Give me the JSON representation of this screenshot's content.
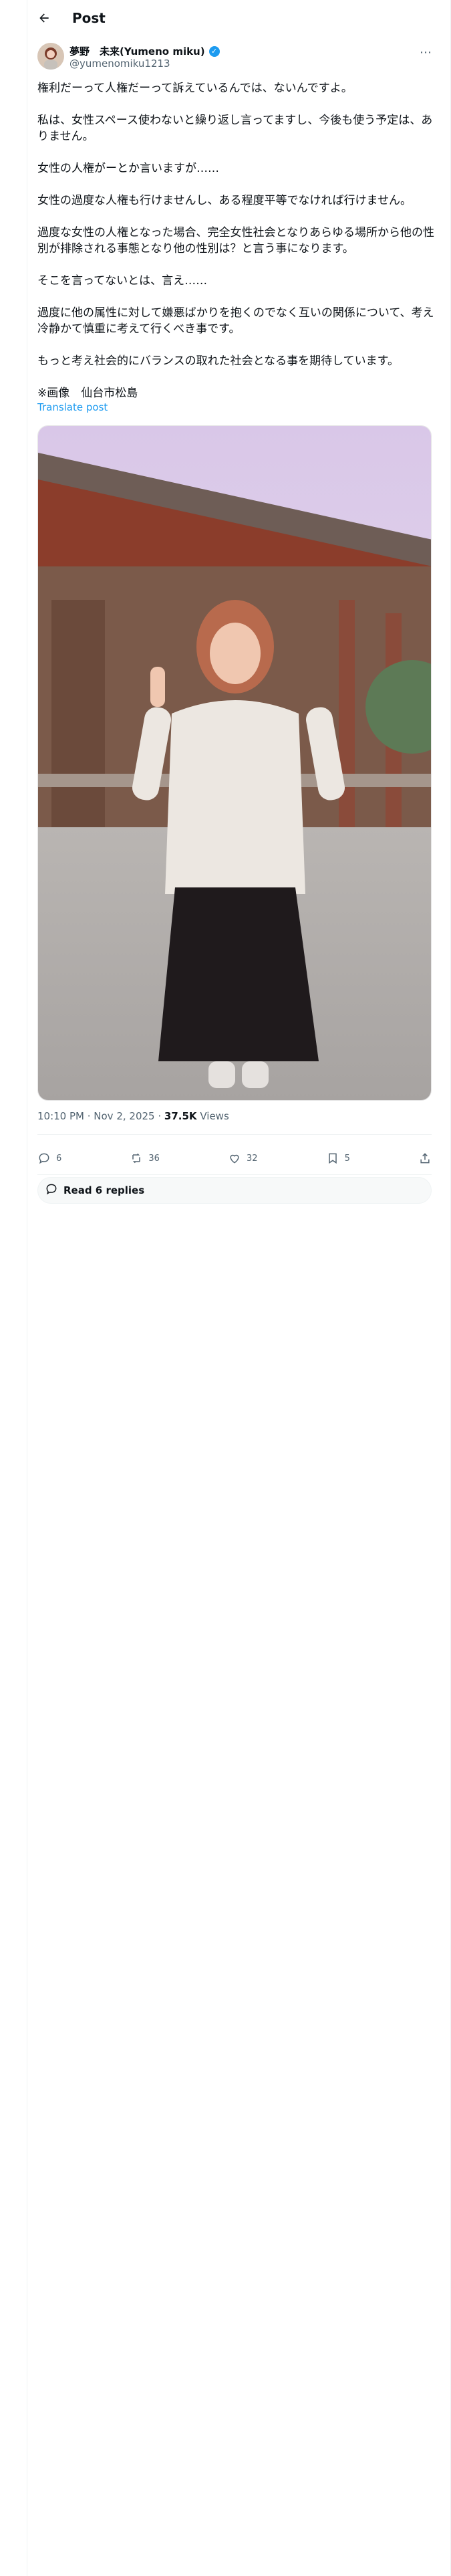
{
  "header": {
    "title": "Post"
  },
  "author": {
    "name": "夢野　未来(Yumeno miku)",
    "handle": "@yumenomiku1213"
  },
  "post": {
    "paragraphs": [
      "権利だーって人権だーって訴えているんでは、ないんですよ。",
      "私は、女性スペース使わないと繰り返し言ってますし、今後も使う予定は、ありません。",
      "女性の人権がーとか言いますが……",
      "女性の過度な人権も行けませんし、ある程度平等でなければ行けません。",
      "過度な女性の人権となった場合、完全女性社会となりあらゆる場所から他の性別が排除される事態となり他の性別は？と言う事になります。",
      "そこを言ってないとは、言え……",
      "過度に他の属性に対して嫌悪ばかりを抱くのでなく互いの関係について、考え冷静かて慎重に考えて行くべき事です。",
      "もっと考え社会的にバランスの取れた社会となる事を期待しています。",
      "※画像　仙台市松島"
    ],
    "translate": "Translate post",
    "time": "10:10 PM · Nov 2, 2025",
    "views_count": "37.5K",
    "views_label": "Views"
  },
  "actions": {
    "replies": "6",
    "reposts": "36",
    "likes": "32",
    "bookmarks": "5"
  },
  "read_replies": "Read 6 replies",
  "icons": [
    "back-arrow-icon",
    "verified-badge-icon",
    "more-icon",
    "reply-icon",
    "repost-icon",
    "like-icon",
    "bookmark-icon",
    "share-icon",
    "speech-bubble-icon"
  ],
  "colors": {
    "accent": "#1d9bf0",
    "text": "#0f1419",
    "muted": "#536471"
  }
}
